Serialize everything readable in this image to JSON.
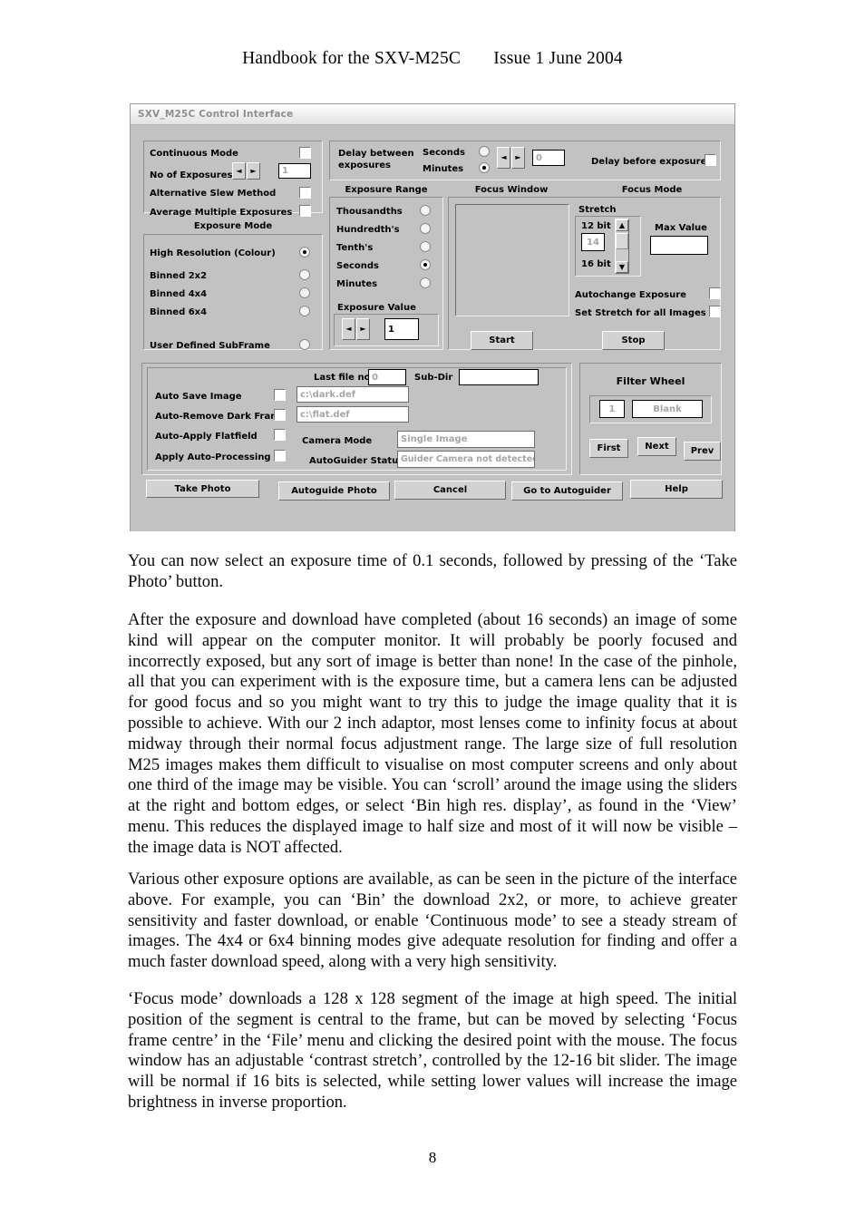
{
  "header": {
    "title": "Handbook for the SXV-M25C",
    "issue": "Issue 1 June 2004"
  },
  "app": {
    "window_title": "SXV_M25C Control Interface",
    "continuous_mode_label": "Continuous Mode",
    "no_of_exposures_label": "No of Exposures",
    "no_of_exposures_value": "1",
    "alternative_slew_label": "Alternative Slew Method",
    "average_multiple_label": "Average Multiple Exposures",
    "exposure_mode_title": "Exposure Mode",
    "exposure_modes": [
      {
        "label": "High Resolution (Colour)",
        "selected": true
      },
      {
        "label": "Binned 2x2",
        "selected": false
      },
      {
        "label": "Binned 4x4",
        "selected": false
      },
      {
        "label": "Binned 6x4",
        "selected": false
      },
      {
        "label": "User Defined SubFrame",
        "selected": false
      }
    ],
    "delay_between_label_line1": "Delay between",
    "delay_between_label_line2": "exposures",
    "delay_units": [
      {
        "label": "Seconds",
        "selected": false
      },
      {
        "label": "Minutes",
        "selected": true
      }
    ],
    "delay_value": "0",
    "delay_before_exposure_label": "Delay before exposure",
    "exposure_range_title": "Exposure Range",
    "focus_window_title": "Focus Window",
    "focus_mode_title": "Focus Mode",
    "exposure_ranges": [
      {
        "label": "Thousandths",
        "selected": false
      },
      {
        "label": "Hundredth's",
        "selected": false
      },
      {
        "label": "Tenth's",
        "selected": false
      },
      {
        "label": "Seconds",
        "selected": true
      },
      {
        "label": "Minutes",
        "selected": false
      }
    ],
    "exposure_value_title": "Exposure Value",
    "exposure_value": "1",
    "stretch_title": "Stretch",
    "stretch_top_label": "12 bit",
    "stretch_bottom_label": "16 bit",
    "stretch_value": "14",
    "max_value_label": "Max Value",
    "max_value": "",
    "autochange_exposure_label": "Autochange Exposure",
    "set_stretch_all_label": "Set Stretch for all Images",
    "start_label": "Start",
    "stop_label": "Stop",
    "last_file_no_label": "Last file no.",
    "last_file_no_value": "0",
    "sub_dir_label": "Sub-Dir",
    "sub_dir_value": "",
    "auto_save_label": "Auto Save Image",
    "auto_remove_dark_label": "Auto-Remove Dark Frame",
    "auto_apply_flat_label": "Auto-Apply Flatfield",
    "apply_auto_processing_label": "Apply Auto-Processing",
    "dark_file_value": "c:\\dark.def",
    "flat_file_value": "c:\\flat.def",
    "camera_mode_label": "Camera Mode",
    "camera_mode_value": "Single Image",
    "autoguider_status_label": "AutoGuider Status",
    "autoguider_status_value": "Guider Camera not detected",
    "filter_wheel_title": "Filter Wheel",
    "filter_position": "1",
    "filter_name": "Blank",
    "filter_first_label": "First",
    "filter_next_label": "Next",
    "filter_prev_label": "Prev",
    "take_photo_label": "Take Photo",
    "autoguide_photo_label": "Autoguide Photo",
    "cancel_label": "Cancel",
    "go_to_autoguider_label": "Go to Autoguider",
    "help_label": "Help",
    "arrow_left": "◄",
    "arrow_right": "►",
    "arrow_up": "▲",
    "arrow_down": "▼"
  },
  "body": {
    "p1": "You can now select an exposure time of 0.1 seconds, followed by pressing of the ‘Take Photo’ button.",
    "p2": "After the exposure and download have completed (about 16 seconds) an image of some kind will appear on the computer monitor. It will probably be poorly focused and incorrectly exposed, but any sort of image is better than none! In the case of the pinhole, all that you can experiment with is the exposure time, but a camera lens can be adjusted for good focus and so you might want to try this to judge the image quality that it is possible to achieve. With our 2 inch adaptor, most lenses come to infinity focus at about midway through their normal focus adjustment range. The large size of full resolution M25 images makes them difficult to visualise on most computer screens and only about one third of the image may be visible. You can ‘scroll’ around the image using the sliders at the right and bottom edges, or select ‘Bin high res. display’, as found in the ‘View’ menu. This reduces the displayed image to half size and most of it will now be visible – the image data is NOT affected.",
    "p3": "Various other exposure options are available, as can be seen in the picture of the interface above. For example, you can ‘Bin’ the download 2x2, or more, to achieve greater sensitivity and faster download, or enable ‘Continuous mode’ to see a steady stream of images. The 4x4 or 6x4 binning modes give adequate resolution for finding and offer a much faster download speed, along with a very high sensitivity.",
    "p4": "‘Focus mode’ downloads a 128 x 128 segment of the image at high speed. The initial position of the segment is central to the frame, but can be moved by selecting ‘Focus frame centre’ in the ‘File’ menu and clicking the desired point with the mouse. The focus window has an adjustable ‘contrast stretch’, controlled by the 12-16 bit slider. The image will be normal if 16 bits is selected, while setting lower values will increase the image brightness in inverse proportion.",
    "page_number": "8"
  }
}
